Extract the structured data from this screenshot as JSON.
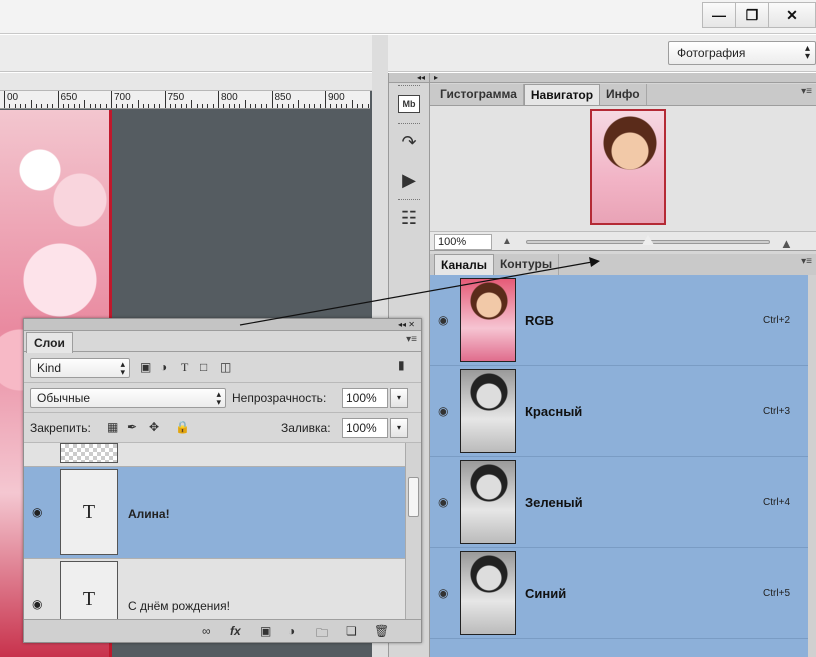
{
  "window": {
    "minimize": "‒",
    "restore": "🗗",
    "close": "✕"
  },
  "workspace": {
    "value": "Фотография"
  },
  "ruler": {
    "labels": [
      "00",
      "650",
      "700",
      "750",
      "800",
      "850",
      "900"
    ]
  },
  "right_panel": {
    "tabs": [
      "Гистограмма",
      "Навигатор",
      "Инфо"
    ],
    "active_tab": "Навигатор",
    "zoom": "100%",
    "channels_tabs": [
      "Каналы",
      "Контуры"
    ],
    "channels": [
      {
        "name": "RGB",
        "shortcut": "Ctrl+2"
      },
      {
        "name": "Красный",
        "shortcut": "Ctrl+3"
      },
      {
        "name": "Зеленый",
        "shortcut": "Ctrl+4"
      },
      {
        "name": "Синий",
        "shortcut": "Ctrl+5"
      }
    ]
  },
  "layers_panel": {
    "tab": "Слои",
    "filter_kind": "Kind",
    "blend_mode": "Обычные",
    "opacity_label": "Непрозрачность:",
    "opacity_value": "100%",
    "lock_label": "Закрепить:",
    "fill_label": "Заливка:",
    "fill_value": "100%",
    "layers": [
      {
        "name": "",
        "thumb": ""
      },
      {
        "name": "Алина!",
        "thumb": "T",
        "selected": true
      },
      {
        "name": "С днём рождения!",
        "thumb": "T",
        "selected": false
      }
    ],
    "footer_fx": "fx"
  },
  "icons": {
    "eye": "eye-icon",
    "link": "link-icon",
    "trash": "trash-icon"
  },
  "colors": {
    "selection": "#8db0d9",
    "panel": "#d6d6d6",
    "doc_bg": "#555c61"
  }
}
